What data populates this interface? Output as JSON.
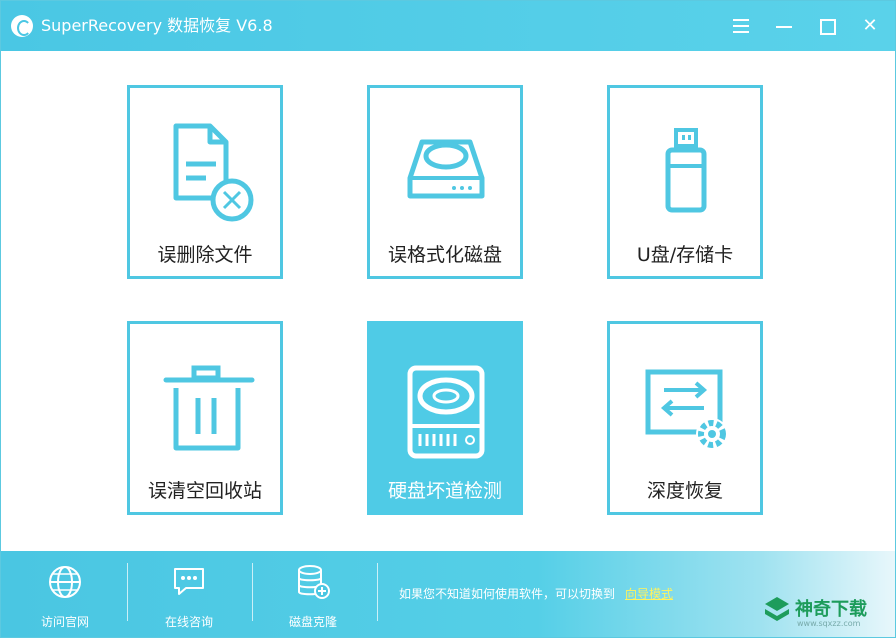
{
  "window": {
    "title": "SuperRecovery 数据恢复 V6.8"
  },
  "titlebar": {
    "menu_icon": "hamburger-icon",
    "min_icon": "minimize-icon",
    "max_icon": "maximize-icon",
    "close_icon": "close-icon",
    "close_glyph": "✕"
  },
  "modes": [
    {
      "label": "误删除文件",
      "icon": "deleted-file-icon"
    },
    {
      "label": "误格式化磁盘",
      "icon": "disk-icon"
    },
    {
      "label": "U盘/存储卡",
      "icon": "usb-drive-icon"
    },
    {
      "label": "误清空回收站",
      "icon": "recycle-bin-icon"
    },
    {
      "label": "硬盘坏道检测",
      "icon": "hard-drive-scan-icon",
      "selected": true
    },
    {
      "label": "深度恢复",
      "icon": "deep-recovery-icon"
    }
  ],
  "footer": {
    "items": [
      {
        "label": "访问官网",
        "icon": "globe-icon"
      },
      {
        "label": "在线咨询",
        "icon": "chat-icon"
      },
      {
        "label": "磁盘克隆",
        "icon": "database-clone-icon"
      }
    ],
    "hint": "如果您不知道如何使用软件，可以切换到",
    "guide_link": "向导模式"
  },
  "watermark": {
    "text": "神奇下载",
    "url": "www.sqxzz.com"
  },
  "colors": {
    "accent": "#4fc7e2",
    "selected_bg": "#4fcbe6",
    "link": "#fff35c",
    "watermark": "#1d9c5b"
  }
}
